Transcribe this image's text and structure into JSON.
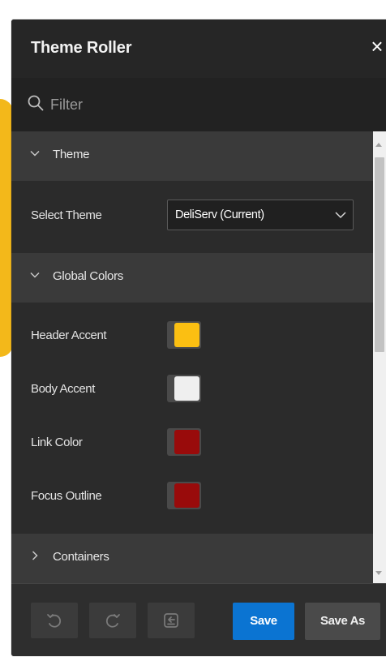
{
  "dialog": {
    "title": "Theme Roller",
    "close_label": "×"
  },
  "filter": {
    "placeholder": "Filter",
    "value": ""
  },
  "sections": {
    "theme": {
      "label": "Theme",
      "expanded": true
    },
    "global_colors": {
      "label": "Global Colors",
      "expanded": true
    },
    "containers": {
      "label": "Containers",
      "expanded": false
    }
  },
  "theme": {
    "select_label": "Select Theme",
    "selected_value": "DeliServ (Current)"
  },
  "global_colors": {
    "header_accent": {
      "label": "Header Accent",
      "color": "#FBBF12"
    },
    "body_accent": {
      "label": "Body Accent",
      "color": "#EFEFEF"
    },
    "link_color": {
      "label": "Link Color",
      "color": "#990B0B"
    },
    "focus_outline": {
      "label": "Focus Outline",
      "color": "#990B0B"
    }
  },
  "footer": {
    "save_label": "Save",
    "save_as_label": "Save As"
  },
  "colors": {
    "dialog_bg": "#2b2b2b",
    "section_header_bg": "#3a3a3a",
    "primary_button": "#0b74d2",
    "page_accent": "#f3b81a"
  },
  "icons": {
    "close": "close-icon",
    "filter": "search-icon",
    "undo": "undo-icon",
    "redo": "redo-icon",
    "reset": "reset-icon"
  }
}
